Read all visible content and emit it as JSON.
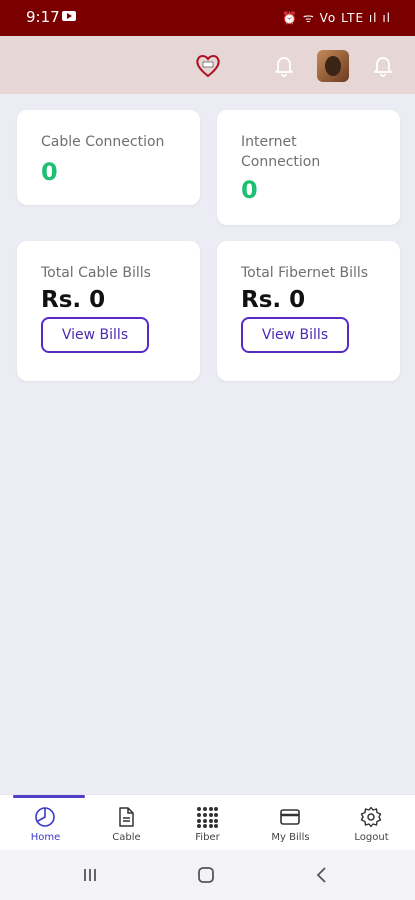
{
  "status_bar": {
    "time": "9:17",
    "right_icons": "⏰ ᯤ Vo LTE ıl ıl"
  },
  "cards": {
    "cable_connection": {
      "label": "Cable Connection",
      "count": "0"
    },
    "internet_connection": {
      "label": "Internet Connection",
      "count": "0"
    },
    "total_cable_bills": {
      "label": "Total Cable Bills",
      "amount": "Rs. 0",
      "button": "View Bills"
    },
    "total_fibernet_bills": {
      "label": "Total Fibernet Bills",
      "amount": "Rs. 0",
      "button": "View Bills"
    }
  },
  "bottom_nav": {
    "home": "Home",
    "cable": "Cable",
    "fiber": "Fiber",
    "my_bills": "My Bills",
    "logout": "Logout"
  },
  "colors": {
    "status_bar": "#7A0000",
    "app_bar": "#E6D6D6",
    "accent": "#4F3FC8",
    "count_green": "#1DBF73",
    "background": "#ECECF5"
  },
  "icons": [
    "youtube-icon",
    "heart-logo-icon",
    "bell-icon",
    "avatar",
    "home-icon",
    "document-icon",
    "grid-icon",
    "card-icon",
    "gear-icon"
  ]
}
